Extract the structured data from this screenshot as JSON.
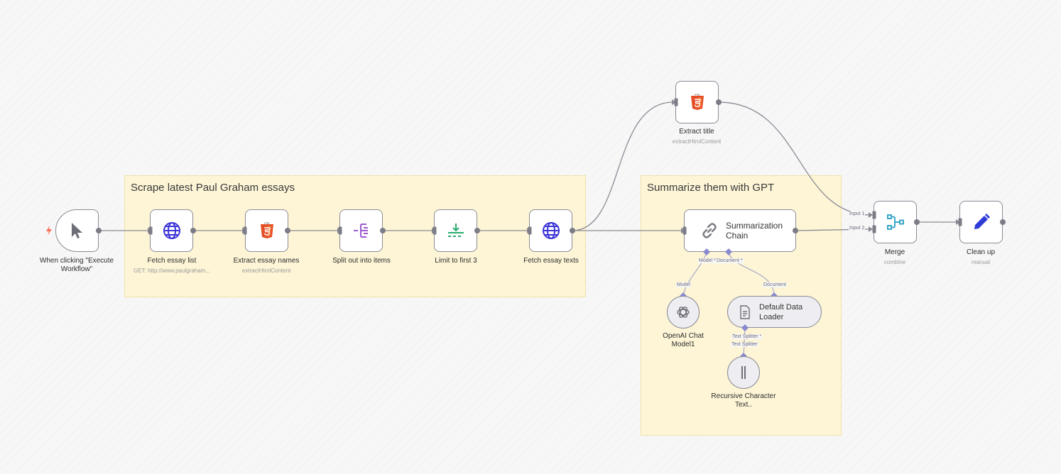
{
  "sticky_scrape": {
    "title": "Scrape latest Paul Graham essays"
  },
  "sticky_summarize": {
    "title": "Summarize them with GPT"
  },
  "nodes": {
    "manual_trigger": {
      "title": "When clicking \"Execute Workflow\"",
      "icon": "pointer-icon"
    },
    "fetch_essay_list": {
      "title": "Fetch essay list",
      "subtitle": "GET: http://www.paulgraham...",
      "icon": "globe-icon"
    },
    "extract_essay_names": {
      "title": "Extract essay names",
      "subtitle": "extractHtmlContent",
      "icon": "html5-icon"
    },
    "split_out": {
      "title": "Split out into items",
      "icon": "split-icon"
    },
    "limit": {
      "title": "Limit to first 3",
      "icon": "limit-icon"
    },
    "fetch_essay_texts": {
      "title": "Fetch essay texts",
      "icon": "globe-icon"
    },
    "extract_title": {
      "title": "Extract title",
      "subtitle": "extractHtmlContent",
      "icon": "html5-icon"
    },
    "summarization_chain": {
      "title": "Summarization Chain",
      "icon": "chain-link-icon"
    },
    "openai_chat_model": {
      "title": "OpenAI Chat Model1",
      "icon": "openai-icon"
    },
    "default_data_loader": {
      "title": "Default Data Loader",
      "icon": "document-icon"
    },
    "recursive_splitter": {
      "title": "Recursive Character Text..",
      "icon": "splitter-icon"
    },
    "merge": {
      "title": "Merge",
      "subtitle": "combine",
      "icon": "merge-icon"
    },
    "clean_up": {
      "title": "Clean up",
      "subtitle": "manual",
      "icon": "pencil-icon"
    }
  },
  "handles": {
    "model_req": "Model *",
    "document_req": "Document *",
    "model": "Model",
    "document": "Document",
    "text_splitter_req": "Text Splitter *",
    "text_splitter": "Text Splitter",
    "input1": "Input 1",
    "input2": "Input 2"
  },
  "colors": {
    "accent_orange": "#e44d26",
    "globe_blue": "#3b32d6",
    "split_purple": "#9b59d0",
    "limit_green": "#2bad6e",
    "merge_teal": "#3aa7c7",
    "pencil_blue": "#2f3bd6",
    "sticky_bg": "#fdf5d6"
  }
}
